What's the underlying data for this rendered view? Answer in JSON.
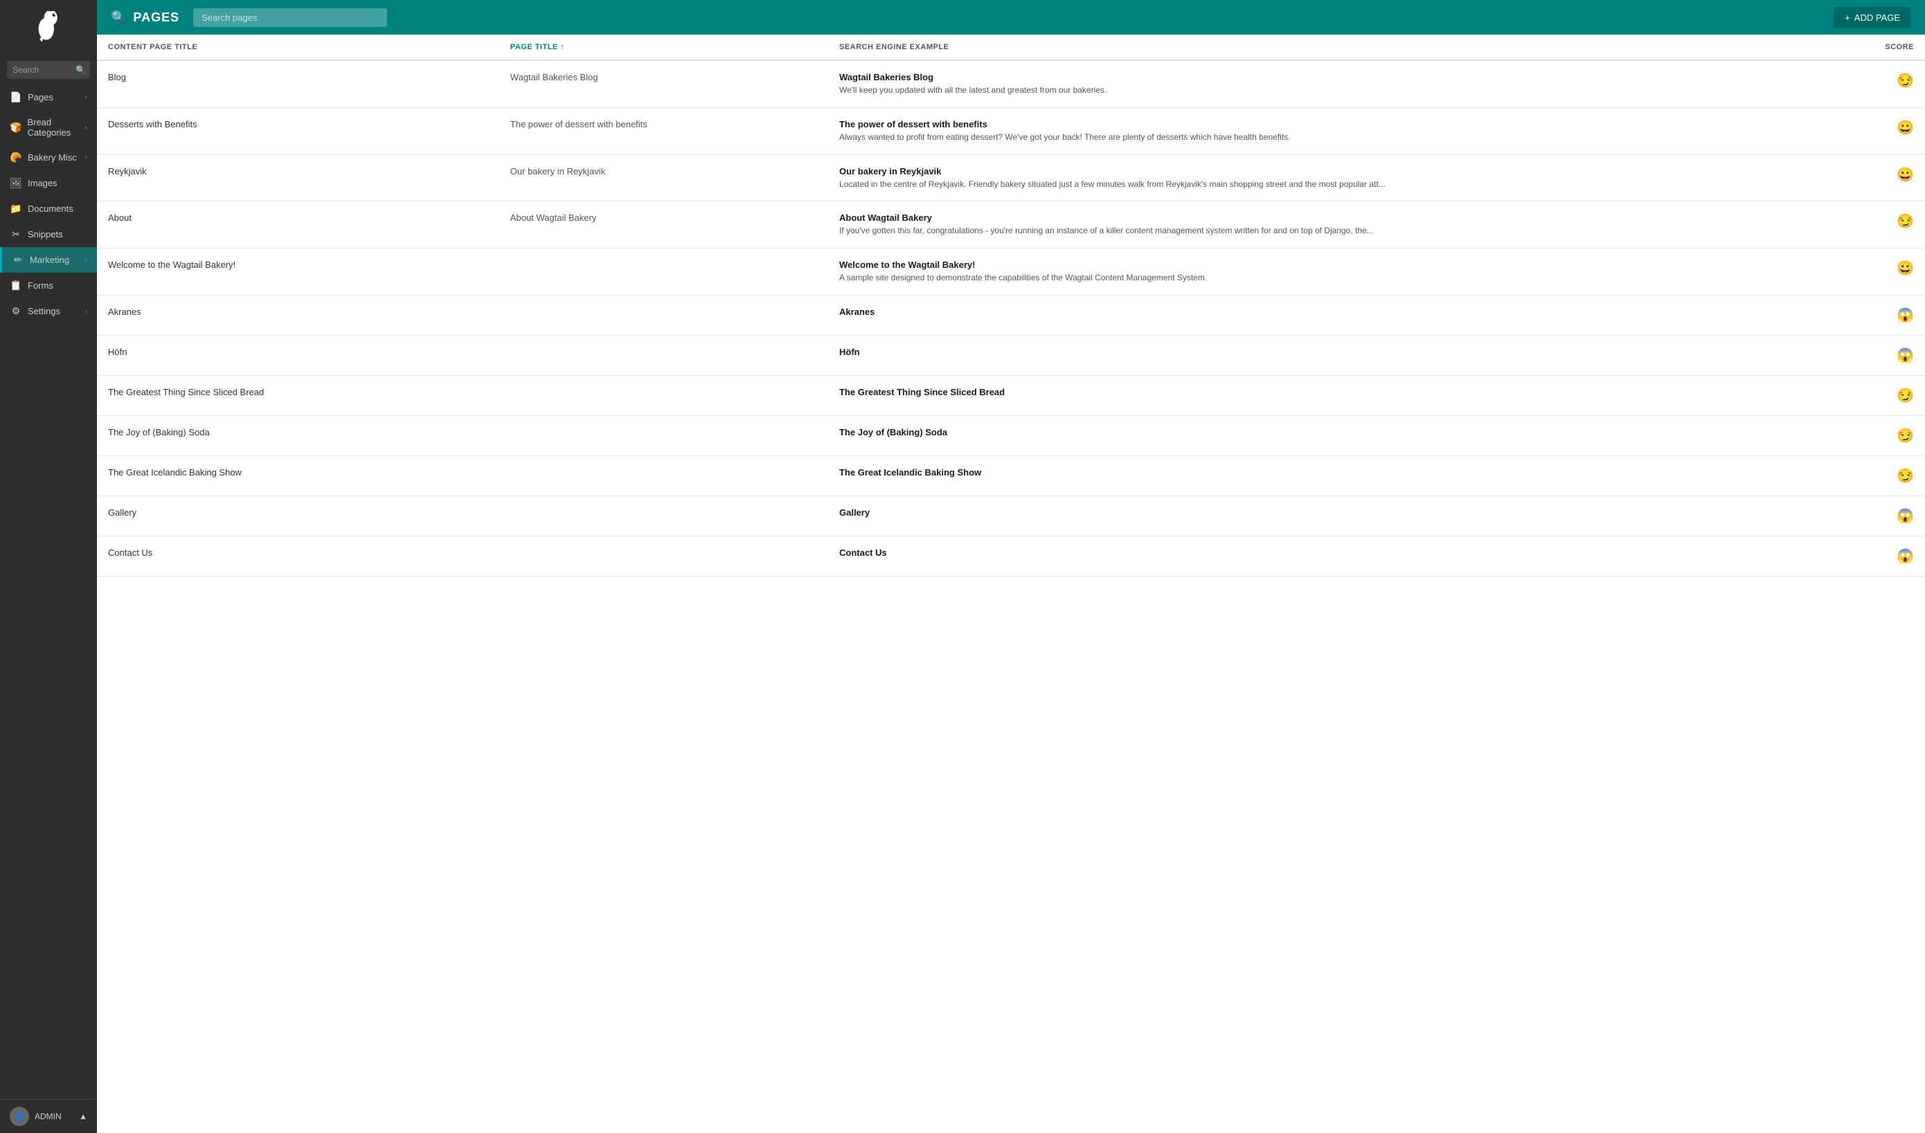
{
  "sidebar": {
    "logo_alt": "Wagtail logo",
    "search_placeholder": "Search",
    "search_label": "Search",
    "nav_items": [
      {
        "id": "pages",
        "label": "Pages",
        "icon": "📄",
        "has_chevron": true,
        "active": false
      },
      {
        "id": "bread-categories",
        "label": "Bread Categories",
        "icon": "🍞",
        "has_chevron": true,
        "active": false
      },
      {
        "id": "bakery-misc",
        "label": "Bakery Misc",
        "icon": "🥐",
        "has_chevron": true,
        "active": false
      },
      {
        "id": "images",
        "label": "Images",
        "icon": "🖼",
        "has_chevron": false,
        "active": false
      },
      {
        "id": "documents",
        "label": "Documents",
        "icon": "📁",
        "has_chevron": false,
        "active": false
      },
      {
        "id": "snippets",
        "label": "Snippets",
        "icon": "✂",
        "has_chevron": false,
        "active": false
      },
      {
        "id": "marketing",
        "label": "Marketing",
        "icon": "✏",
        "has_chevron": true,
        "active": true
      },
      {
        "id": "forms",
        "label": "Forms",
        "icon": "📋",
        "has_chevron": false,
        "active": false
      },
      {
        "id": "settings",
        "label": "Settings",
        "icon": "⚙",
        "has_chevron": true,
        "active": false
      }
    ],
    "footer": {
      "user": "ADMIN",
      "chevron": "▲"
    }
  },
  "header": {
    "search_icon": "🔍",
    "title": "PAGES",
    "search_placeholder": "Search pages",
    "add_button_label": "ADD PAGE",
    "add_icon": "+"
  },
  "table": {
    "columns": [
      {
        "id": "content-title",
        "label": "CONTENT PAGE TITLE",
        "sortable": false
      },
      {
        "id": "page-title",
        "label": "PAGE TITLE",
        "sortable": true,
        "sort_dir": "↑"
      },
      {
        "id": "seo",
        "label": "SEARCH ENGINE EXAMPLE",
        "sortable": false
      },
      {
        "id": "score",
        "label": "SCORE",
        "sortable": false
      }
    ],
    "rows": [
      {
        "content_title": "Blog",
        "page_title": "Wagtail Bakeries Blog",
        "seo_title": "Wagtail Bakeries Blog",
        "seo_desc": "We'll keep you updated with all the latest and greatest from our bakeries.",
        "score": "😏"
      },
      {
        "content_title": "Desserts with Benefits",
        "page_title": "The power of dessert with benefits",
        "seo_title": "The power of dessert with benefits",
        "seo_desc": "Always wanted to profit from eating dessert? We've got your back! There are plenty of desserts which have health benefits.",
        "score": "😀"
      },
      {
        "content_title": "Reykjavik",
        "page_title": "Our bakery in Reykjavik",
        "seo_title": "Our bakery in Reykjavik",
        "seo_desc": "Located in the centre of Reykjavik. Friendly bakery situated just a few minutes walk from Reykjavik's main shopping street and the most popular att...",
        "score": "😀"
      },
      {
        "content_title": "About",
        "page_title": "About Wagtail Bakery",
        "seo_title": "About Wagtail Bakery",
        "seo_desc": "If you've gotten this far, congratulations - you're running an instance of a killer content management system written for and on top of Django, the...",
        "score": "😏"
      },
      {
        "content_title": "Welcome to the Wagtail Bakery!",
        "page_title": "",
        "seo_title": "Welcome to the Wagtail Bakery!",
        "seo_desc": "A sample site designed to demonstrate the capabilities of the Wagtail Content Management System.",
        "score": "😀"
      },
      {
        "content_title": "Akranes",
        "page_title": "",
        "seo_title": "Akranes",
        "seo_desc": "",
        "score": "😱"
      },
      {
        "content_title": "Höfn",
        "page_title": "",
        "seo_title": "Höfn",
        "seo_desc": "",
        "score": "😱"
      },
      {
        "content_title": "The Greatest Thing Since Sliced Bread",
        "page_title": "",
        "seo_title": "The Greatest Thing Since Sliced Bread",
        "seo_desc": "",
        "score": "😏"
      },
      {
        "content_title": "The Joy of (Baking) Soda",
        "page_title": "",
        "seo_title": "The Joy of (Baking) Soda",
        "seo_desc": "",
        "score": "😏"
      },
      {
        "content_title": "The Great Icelandic Baking Show",
        "page_title": "",
        "seo_title": "The Great Icelandic Baking Show",
        "seo_desc": "",
        "score": "😏"
      },
      {
        "content_title": "Gallery",
        "page_title": "",
        "seo_title": "Gallery",
        "seo_desc": "",
        "score": "😱"
      },
      {
        "content_title": "Contact Us",
        "page_title": "",
        "seo_title": "Contact Us",
        "seo_desc": "",
        "score": "😱"
      }
    ]
  },
  "colors": {
    "teal": "#00827f",
    "sidebar_bg": "#2e2e2e",
    "sidebar_active": "#1a6b6b"
  }
}
